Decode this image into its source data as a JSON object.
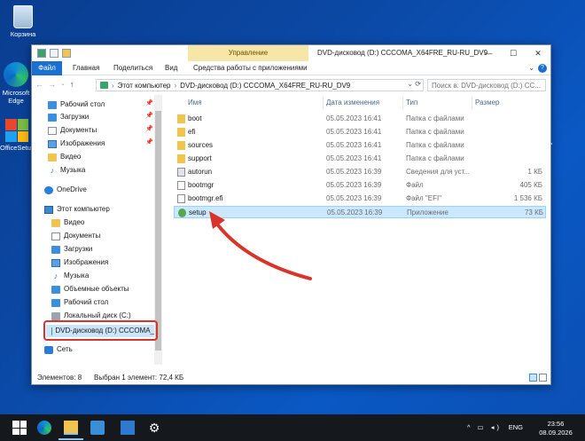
{
  "desktop": {
    "icons": [
      {
        "label": "Корзина",
        "icon": "recycle-bin-icon"
      },
      {
        "label": "Microsoft Edge",
        "icon": "edge-icon"
      },
      {
        "label": "OfficeSetup",
        "icon": "office-icon"
      }
    ]
  },
  "window": {
    "title": "DVD-дисковод (D:) CCCOMA_X64FRE_RU-RU_DV9",
    "manage_context_tab": "Управление",
    "ribbon_tabs": [
      "Файл",
      "Главная",
      "Поделиться",
      "Вид",
      "Средства работы с приложениями"
    ],
    "controls": {
      "minimize": "—",
      "maximize": "☐",
      "close": "✕"
    }
  },
  "navigation": {
    "back": "←",
    "forward": "→",
    "up": "↑",
    "address": [
      "Этот компьютер",
      "DVD-дисковод (D:) CCCOMA_X64FRE_RU-RU_DV9"
    ],
    "search_placeholder": "Поиск в: DVD-дисковод (D:) CC..."
  },
  "nav_pane": {
    "quick_access": [
      {
        "label": "Рабочий стол",
        "pinned": true
      },
      {
        "label": "Загрузки",
        "pinned": true
      },
      {
        "label": "Документы",
        "pinned": true
      },
      {
        "label": "Изображения",
        "pinned": true
      },
      {
        "label": "Видео",
        "pinned": false
      },
      {
        "label": "Музыка",
        "pinned": false
      }
    ],
    "onedrive": "OneDrive",
    "this_pc": "Этот компьютер",
    "this_pc_items": [
      "Видео",
      "Документы",
      "Загрузки",
      "Изображения",
      "Музыка",
      "Объемные объекты",
      "Рабочий стол",
      "Локальный диск (C:)",
      "DVD-дисковод (D:) CCCOMA_"
    ],
    "network": "Сеть",
    "pin_glyph": "📌"
  },
  "columns": {
    "name": "Имя",
    "date": "Дата изменения",
    "type": "Тип",
    "size": "Размер"
  },
  "files": [
    {
      "name": "boot",
      "date": "05.05.2023 16:41",
      "type": "Папка с файлами",
      "size": "",
      "kind": "folder"
    },
    {
      "name": "efi",
      "date": "05.05.2023 16:41",
      "type": "Папка с файлами",
      "size": "",
      "kind": "folder"
    },
    {
      "name": "sources",
      "date": "05.05.2023 16:41",
      "type": "Папка с файлами",
      "size": "",
      "kind": "folder"
    },
    {
      "name": "support",
      "date": "05.05.2023 16:41",
      "type": "Папка с файлами",
      "size": "",
      "kind": "folder"
    },
    {
      "name": "autorun",
      "date": "05.05.2023 16:39",
      "type": "Сведения для уст...",
      "size": "1 КБ",
      "kind": "inf"
    },
    {
      "name": "bootmgr",
      "date": "05.05.2023 16:39",
      "type": "Файл",
      "size": "405 КБ",
      "kind": "file"
    },
    {
      "name": "bootmgr.efi",
      "date": "05.05.2023 16:39",
      "type": "Файл \"EFI\"",
      "size": "1 536 КБ",
      "kind": "file"
    },
    {
      "name": "setup",
      "date": "05.05.2023 16:39",
      "type": "Приложение",
      "size": "73 КБ",
      "kind": "app",
      "selected": true
    }
  ],
  "status": {
    "count": "Элементов: 8",
    "selection": "Выбран 1 элемент: 72,4 КБ"
  },
  "taskbar": {
    "lang": "ENG",
    "time": "23:56",
    "date": "08.09.2026",
    "tray_glyphs": "^ ▭ ◂)"
  }
}
